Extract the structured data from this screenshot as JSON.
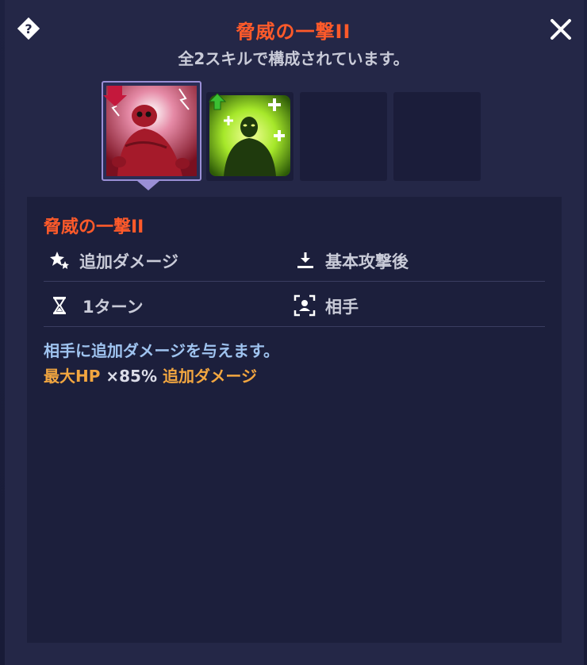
{
  "header": {
    "title": "脅威の一撃II",
    "subtitle": "全2スキルで構成されています。"
  },
  "skills": [
    {
      "name": "red-demon-skill-icon",
      "state": "selected",
      "badge": "debuff-arrow-down"
    },
    {
      "name": "green-buff-skill-icon",
      "state": "normal",
      "badge": "buff-arrow-up"
    },
    {
      "name": "empty-slot",
      "state": "empty"
    },
    {
      "name": "empty-slot",
      "state": "empty"
    }
  ],
  "detail": {
    "skill_name": "脅威の一撃II",
    "attributes": {
      "type": "追加ダメージ",
      "timing": "基本攻撃後",
      "duration": "1ターン",
      "target": "相手"
    },
    "description": "相手に追加ダメージを与えます。",
    "effect": {
      "stat": "最大HP",
      "multiplier": "×85%",
      "result": "追加ダメージ"
    }
  },
  "colors": {
    "title": "#ff5a2a",
    "description": "#9fc3ef",
    "effect_highlight": "#f2a640",
    "panel": "#242747",
    "detail_box": "#1c1f3c"
  }
}
